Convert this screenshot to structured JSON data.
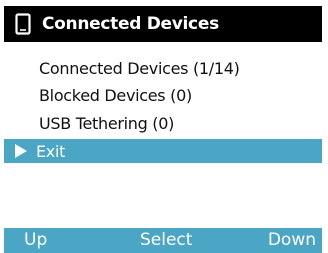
{
  "header": {
    "icon": "phone-icon",
    "title": "Connected Devices"
  },
  "menu": {
    "items": [
      {
        "label": "Connected Devices (1/14)",
        "selected": false
      },
      {
        "label": "Blocked Devices (0)",
        "selected": false
      },
      {
        "label": "USB Tethering (0)",
        "selected": false
      },
      {
        "label": "Exit",
        "selected": true
      }
    ]
  },
  "softkeys": {
    "left": "Up",
    "center": "Select",
    "right": "Down"
  },
  "colors": {
    "header_bg": "#000000",
    "accent": "#4aa6c4",
    "text": "#111111"
  }
}
